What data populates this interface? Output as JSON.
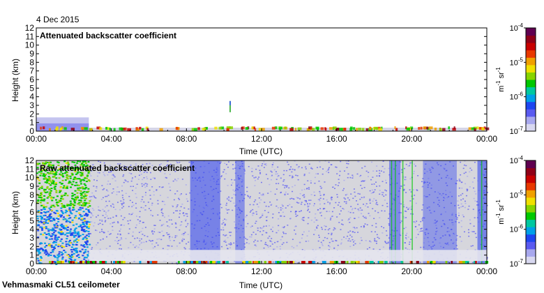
{
  "date": "4 Dec 2015",
  "footer": "Vehmasmaki CL51 ceilometer",
  "chart_data": [
    {
      "type": "heatmap",
      "title": "Attenuated backscatter coefficient",
      "xlabel": "Time (UTC)",
      "ylabel": "Height (km)",
      "x_ticks": [
        "00:00",
        "04:00",
        "08:00",
        "12:00",
        "16:00",
        "20:00",
        "00:00"
      ],
      "y_ticks": [
        "0",
        "1",
        "2",
        "3",
        "4",
        "5",
        "6",
        "7",
        "8",
        "9",
        "10",
        "11",
        "12"
      ],
      "xlim_hours": [
        0,
        24
      ],
      "ylim_km": [
        0,
        12
      ],
      "colorbar": {
        "scale": "log",
        "min_exp": -7,
        "max_exp": -4,
        "ticks": [
          "10",
          "10",
          "10",
          "10"
        ],
        "tick_exps": [
          "-7",
          "-6",
          "-5",
          "-4"
        ],
        "unit_base1": "m",
        "unit_exp1": "-1",
        "unit_base2": "sr",
        "unit_exp2": "-1"
      }
    },
    {
      "type": "heatmap",
      "title": "Raw attenuated backscatter coefficient",
      "xlabel": "Time (UTC)",
      "ylabel": "Height (km)",
      "x_ticks": [
        "00:00",
        "04:00",
        "08:00",
        "12:00",
        "16:00",
        "20:00",
        "00:00"
      ],
      "y_ticks": [
        "0",
        "1",
        "2",
        "3",
        "4",
        "5",
        "6",
        "7",
        "8",
        "9",
        "10",
        "11",
        "12"
      ],
      "xlim_hours": [
        0,
        24
      ],
      "ylim_km": [
        0,
        12
      ],
      "colorbar": {
        "scale": "log",
        "min_exp": -7,
        "max_exp": -4,
        "ticks": [
          "10",
          "10",
          "10",
          "10"
        ],
        "tick_exps": [
          "-7",
          "-6",
          "-5",
          "-4"
        ],
        "unit_base1": "m",
        "unit_exp1": "-1",
        "unit_base2": "sr",
        "unit_exp2": "-1"
      }
    }
  ]
}
